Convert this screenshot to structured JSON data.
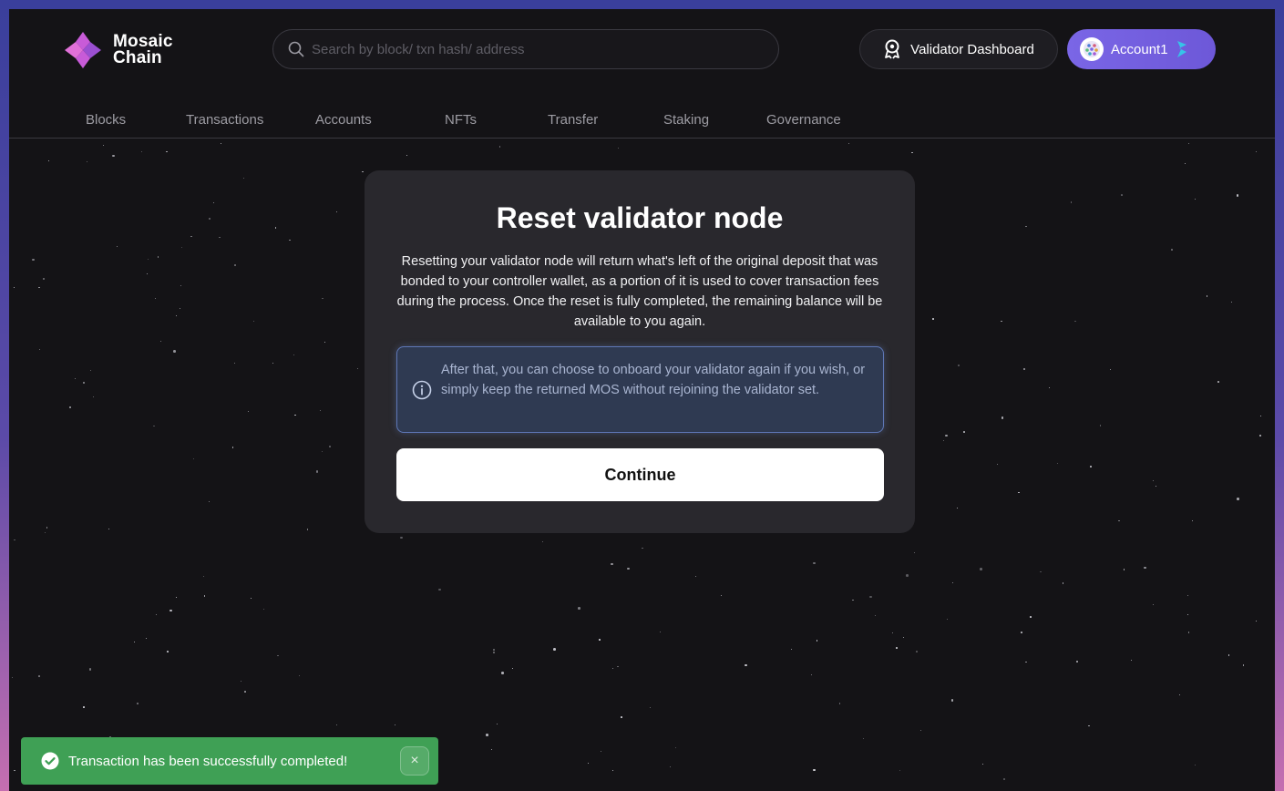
{
  "brand": {
    "line1": "Mosaic",
    "line2": "Chain"
  },
  "search": {
    "placeholder": "Search by block/ txn hash/ address"
  },
  "header": {
    "validator_dashboard": "Validator Dashboard",
    "account": "Account1"
  },
  "nav": {
    "items": [
      "Blocks",
      "Transactions",
      "Accounts",
      "NFTs",
      "Transfer",
      "Staking",
      "Governance"
    ]
  },
  "modal": {
    "title": "Reset validator node",
    "description": "Resetting your validator node will return what's left of the original deposit that was bonded to your controller wallet, as a portion of it is used to cover transaction fees during the process. Once the reset is fully completed, the remaining balance will be available to you again.",
    "info": "After that, you can choose to onboard your validator again if you wish, or simply keep the returned MOS without rejoining the validator set.",
    "continue": "Continue"
  },
  "toast": {
    "message": "Transaction has been successfully completed!",
    "close": "×"
  },
  "colors": {
    "accent": "#7a66e6",
    "success": "#3fa055",
    "background": "#141316",
    "info_border": "#5e77b6"
  }
}
